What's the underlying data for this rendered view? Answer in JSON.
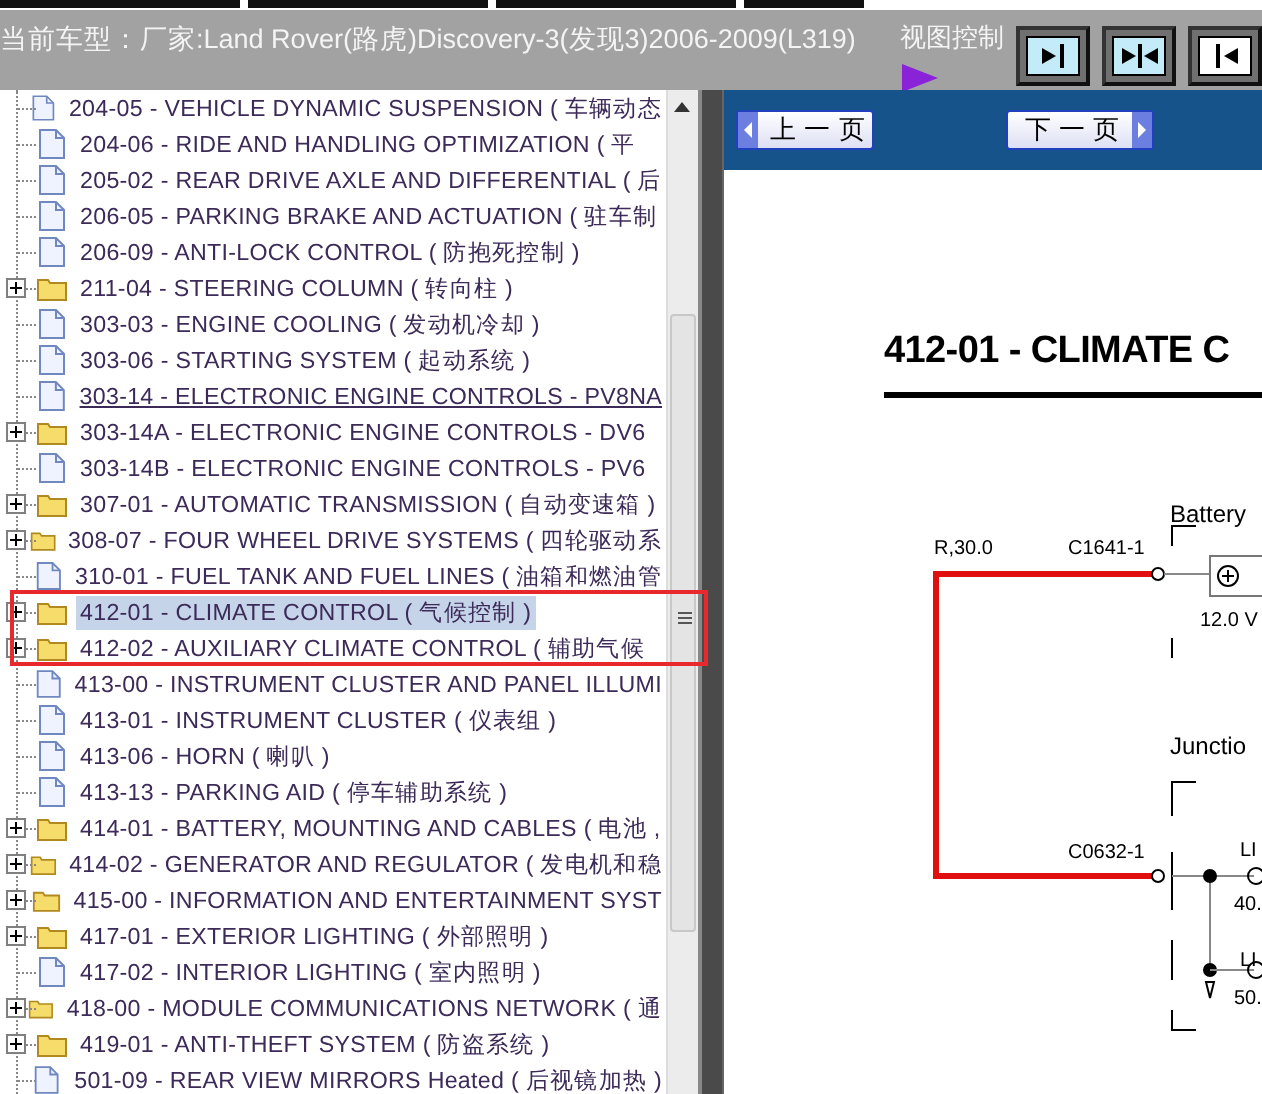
{
  "header": {
    "vehicle_label": "当前车型：厂家:Land Rover(路虎)Discovery-3(发现3)2006-2009(L319)",
    "view_control_label": "视图控制"
  },
  "tree": {
    "items": [
      {
        "kind": "document",
        "label": "204-05 - VEHICLE DYNAMIC SUSPENSION ( 车辆动态",
        "selected": false,
        "hovered": false
      },
      {
        "kind": "document",
        "label": "204-06 - RIDE AND HANDLING OPTIMIZATION ( 平",
        "selected": false,
        "hovered": false
      },
      {
        "kind": "document",
        "label": "205-02 - REAR DRIVE AXLE AND DIFFERENTIAL ( 后",
        "selected": false,
        "hovered": false
      },
      {
        "kind": "document",
        "label": "206-05 - PARKING BRAKE AND ACTUATION ( 驻车制",
        "selected": false,
        "hovered": false
      },
      {
        "kind": "document",
        "label": "206-09 - ANTI-LOCK CONTROL ( 防抱死控制 )",
        "selected": false,
        "hovered": false
      },
      {
        "kind": "folder",
        "label": "211-04 - STEERING COLUMN ( 转向柱 )",
        "selected": false,
        "hovered": false
      },
      {
        "kind": "document",
        "label": "303-03 - ENGINE COOLING ( 发动机冷却 )",
        "selected": false,
        "hovered": false
      },
      {
        "kind": "document",
        "label": "303-06 - STARTING SYSTEM ( 起动系统 )",
        "selected": false,
        "hovered": false
      },
      {
        "kind": "document",
        "label": "303-14 - ELECTRONIC ENGINE CONTROLS - PV8NA",
        "selected": false,
        "hovered": true
      },
      {
        "kind": "folder",
        "label": "303-14A - ELECTRONIC ENGINE CONTROLS - DV6",
        "selected": false,
        "hovered": false
      },
      {
        "kind": "document",
        "label": "303-14B - ELECTRONIC ENGINE CONTROLS - PV6",
        "selected": false,
        "hovered": false
      },
      {
        "kind": "folder",
        "label": "307-01 - AUTOMATIC TRANSMISSION ( 自动变速箱 )",
        "selected": false,
        "hovered": false
      },
      {
        "kind": "folder",
        "label": "308-07 - FOUR WHEEL DRIVE SYSTEMS ( 四轮驱动系",
        "selected": false,
        "hovered": false
      },
      {
        "kind": "document",
        "label": "310-01 - FUEL TANK AND FUEL LINES ( 油箱和燃油管",
        "selected": false,
        "hovered": false
      },
      {
        "kind": "folder",
        "label": "412-01 - CLIMATE CONTROL ( 气候控制 )",
        "selected": true,
        "hovered": false
      },
      {
        "kind": "folder",
        "label": "412-02 - AUXILIARY CLIMATE CONTROL ( 辅助气候",
        "selected": false,
        "hovered": false
      },
      {
        "kind": "document",
        "label": "413-00 - INSTRUMENT CLUSTER AND PANEL ILLUMI",
        "selected": false,
        "hovered": false
      },
      {
        "kind": "document",
        "label": "413-01 - INSTRUMENT CLUSTER ( 仪表组 )",
        "selected": false,
        "hovered": false
      },
      {
        "kind": "document",
        "label": "413-06 - HORN ( 喇叭 )",
        "selected": false,
        "hovered": false
      },
      {
        "kind": "document",
        "label": "413-13 - PARKING AID ( 停车辅助系统 )",
        "selected": false,
        "hovered": false
      },
      {
        "kind": "folder",
        "label": "414-01 - BATTERY, MOUNTING AND CABLES ( 电池 ,",
        "selected": false,
        "hovered": false
      },
      {
        "kind": "folder",
        "label": "414-02 - GENERATOR AND REGULATOR ( 发电机和稳",
        "selected": false,
        "hovered": false
      },
      {
        "kind": "folder",
        "label": "415-00 - INFORMATION AND ENTERTAINMENT SYST",
        "selected": false,
        "hovered": false
      },
      {
        "kind": "folder",
        "label": "417-01 - EXTERIOR LIGHTING ( 外部照明 )",
        "selected": false,
        "hovered": false
      },
      {
        "kind": "document",
        "label": "417-02 - INTERIOR LIGHTING ( 室内照明 )",
        "selected": false,
        "hovered": false
      },
      {
        "kind": "folder",
        "label": "418-00 - MODULE COMMUNICATIONS NETWORK ( 通",
        "selected": false,
        "hovered": false
      },
      {
        "kind": "folder",
        "label": "419-01 - ANTI-THEFT SYSTEM ( 防盗系统 )",
        "selected": false,
        "hovered": false
      },
      {
        "kind": "document",
        "label": "501-09 - REAR VIEW MIRRORS Heated ( 后视镜加热 )",
        "selected": false,
        "hovered": false
      }
    ]
  },
  "doc_nav": {
    "prev": "上 一 页",
    "next": "下 一 页"
  },
  "document": {
    "title": "412-01 - CLIMATE C",
    "battery_label": "Battery",
    "wire_label": "R,30.0",
    "connector_top": "C1641-1",
    "voltage": "12.0 V",
    "junction_label": "Junctio",
    "connector_bottom": "C0632-1",
    "link_top": "LI",
    "link_top_value": "40.",
    "link_bottom": "LI",
    "link_bottom_value": "50."
  }
}
